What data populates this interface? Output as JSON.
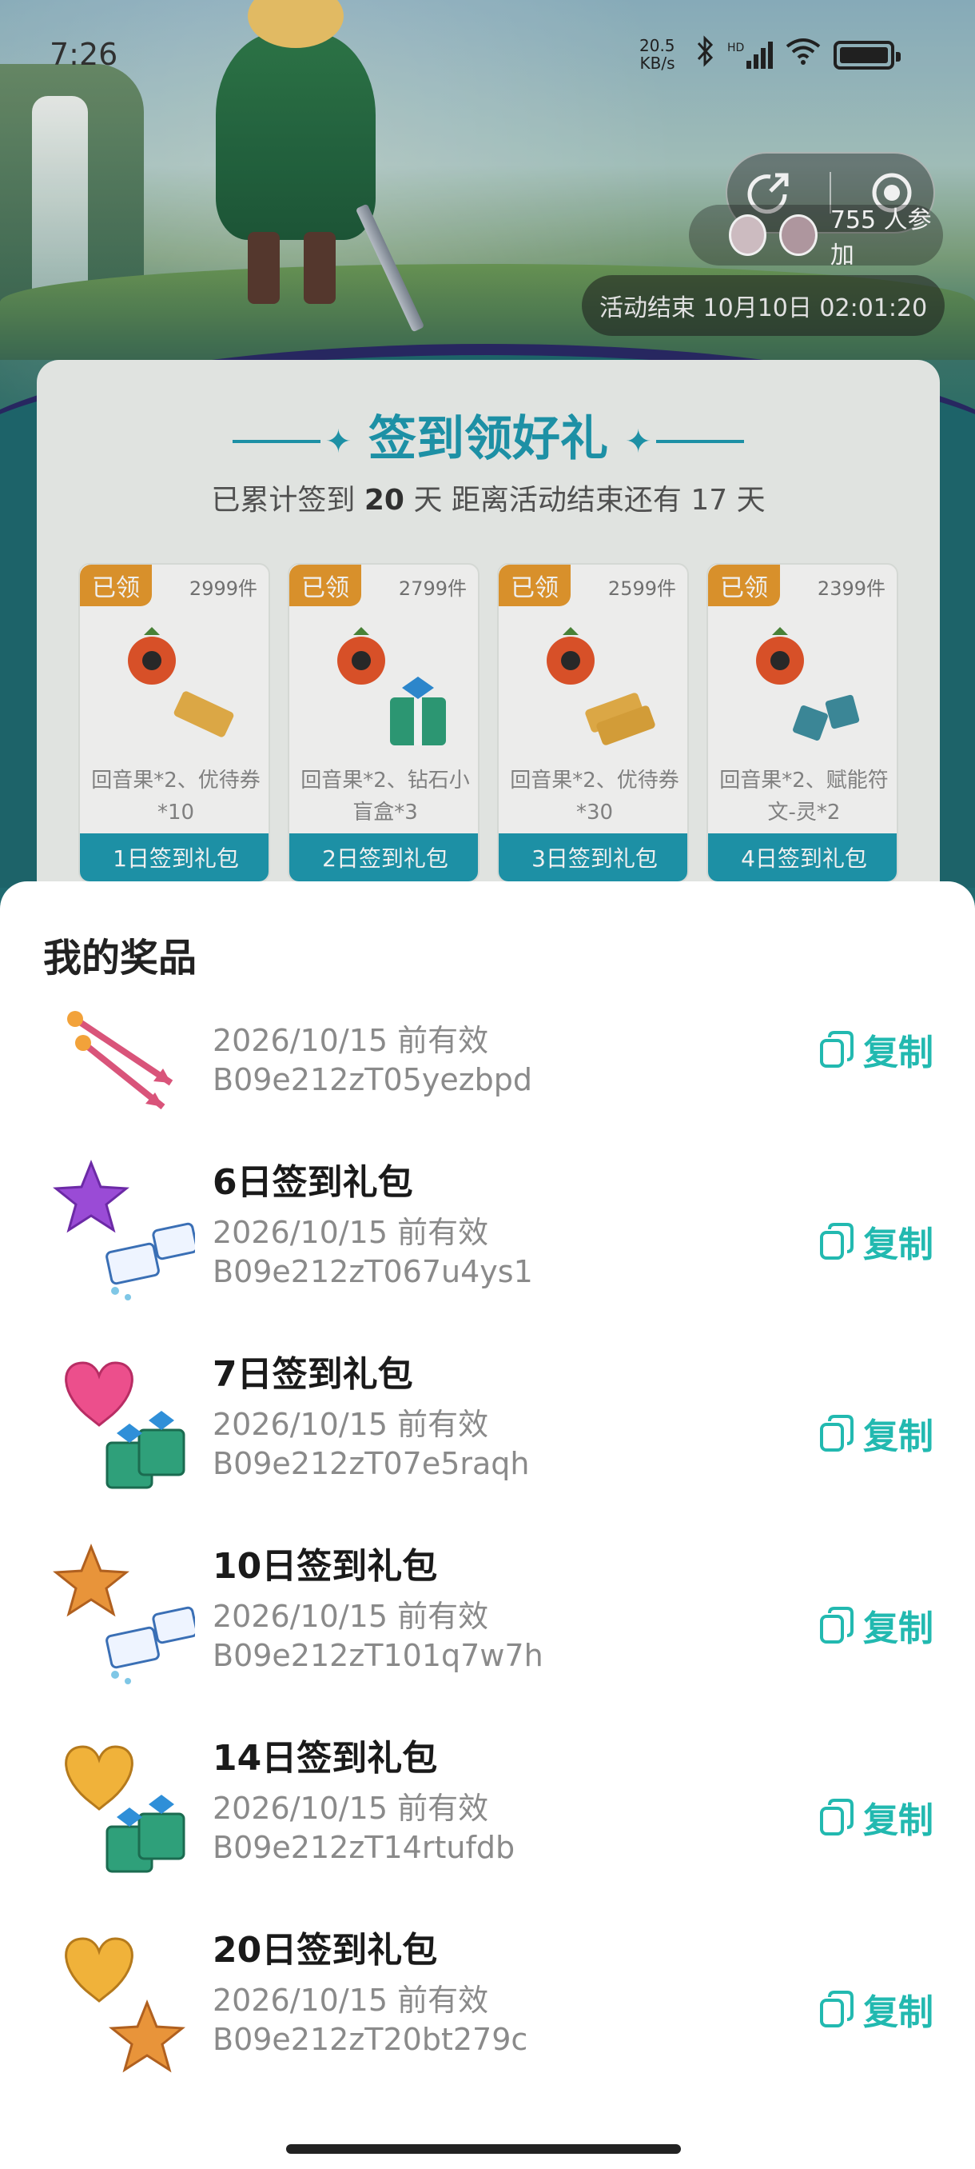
{
  "status_bar": {
    "time": "7:26",
    "net_speed_value": "20.5",
    "net_speed_unit": "KB/s",
    "signal_label": "HD"
  },
  "header": {
    "participants_text": "755 人参加",
    "end_time_text": "活动结束 10月10日 02:01:20"
  },
  "signin_card": {
    "title": "签到领好礼",
    "summary_prefix": "已累计签到",
    "summary_days": "20",
    "summary_suffix": "天  距离活动结束还有 17 天",
    "gifts": [
      {
        "tag": "已领",
        "count": "2999件",
        "label": "回音果*2、优待券*10",
        "footer": "1日签到礼包"
      },
      {
        "tag": "已领",
        "count": "2799件",
        "label": "回音果*2、钻石小盲盒*3",
        "footer": "2日签到礼包"
      },
      {
        "tag": "已领",
        "count": "2599件",
        "label": "回音果*2、优待券*30",
        "footer": "3日签到礼包"
      },
      {
        "tag": "已领",
        "count": "2399件",
        "label": "回音果*2、赋能符文-灵*2",
        "footer": "4日签到礼包"
      }
    ]
  },
  "prizes_sheet": {
    "title": "我的奖品",
    "copy_label": "复制",
    "items": [
      {
        "name": "",
        "valid": "2026/10/15 前有效",
        "code": "B09e212zT05yezbpd",
        "icon": "arrows-icon"
      },
      {
        "name": "6日签到礼包",
        "valid": "2026/10/15 前有效",
        "code": "B09e212zT067u4ys1",
        "icon": "purple-star-ticket-icon"
      },
      {
        "name": "7日签到礼包",
        "valid": "2026/10/15 前有效",
        "code": "B09e212zT07e5raqh",
        "icon": "pink-heart-giftbox-icon"
      },
      {
        "name": "10日签到礼包",
        "valid": "2026/10/15 前有效",
        "code": "B09e212zT101q7w7h",
        "icon": "orange-star-ticket-icon"
      },
      {
        "name": "14日签到礼包",
        "valid": "2026/10/15 前有效",
        "code": "B09e212zT14rtufdb",
        "icon": "gold-heart-giftbox-icon"
      },
      {
        "name": "20日签到礼包",
        "valid": "2026/10/15 前有效",
        "code": "B09e212zT20bt279c",
        "icon": "gold-heart-star-icon"
      }
    ]
  },
  "colors": {
    "accent": "#22b9b0",
    "card_blue": "#1f9ab0",
    "tag_orange": "#e69a2e"
  }
}
